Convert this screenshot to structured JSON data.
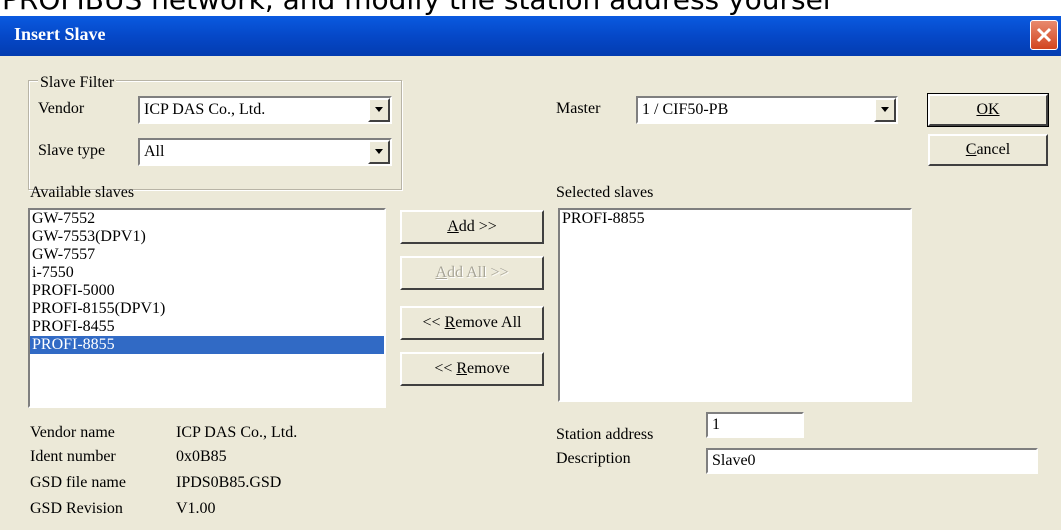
{
  "banner": {
    "text": "PROFIBUS network, and modify the station address yoursel"
  },
  "window": {
    "title": "Insert Slave"
  },
  "slave_filter": {
    "group_label": "Slave Filter",
    "vendor_label": "Vendor",
    "vendor_value": "ICP DAS Co., Ltd.",
    "slave_type_label": "Slave type",
    "slave_type_value": "All"
  },
  "master": {
    "label": "Master",
    "value": "1 / CIF50-PB"
  },
  "buttons": {
    "ok": "OK",
    "cancel_rest": "ancel",
    "cancel_mnemonic": "C",
    "add_mnemonic": "A",
    "add_rest": "dd >>",
    "add_all_mnemonic": "A",
    "add_all_rest": "dd All >>",
    "remove_all_prefix": "<< ",
    "remove_all_mnemonic": "R",
    "remove_all_rest": "emove All",
    "remove_prefix": "<< ",
    "remove_mnemonic": "R",
    "remove_rest": "emove"
  },
  "available": {
    "label": "Available slaves",
    "items": [
      "GW-7552",
      "GW-7553(DPV1)",
      "GW-7557",
      "i-7550",
      "PROFI-5000",
      "PROFI-8155(DPV1)",
      "PROFI-8455",
      "PROFI-8855"
    ],
    "selected_index": 7
  },
  "selected": {
    "label": "Selected slaves",
    "items": [
      "PROFI-8855"
    ]
  },
  "info": {
    "vendor_name_label": "Vendor name",
    "vendor_name_value": "ICP DAS Co., Ltd.",
    "ident_label": "Ident number",
    "ident_value": "0x0B85",
    "gsd_file_label": "GSD file name",
    "gsd_file_value": "IPDS0B85.GSD",
    "gsd_rev_label": "GSD Revision",
    "gsd_rev_value": "V1.00"
  },
  "station": {
    "address_label": "Station address",
    "address_value": "1",
    "description_label": "Description",
    "description_value": "Slave0"
  },
  "colors": {
    "titlebar": "#0548c8",
    "dialog_bg": "#ece9d8",
    "selection": "#316ac5",
    "close": "#d2451f"
  }
}
